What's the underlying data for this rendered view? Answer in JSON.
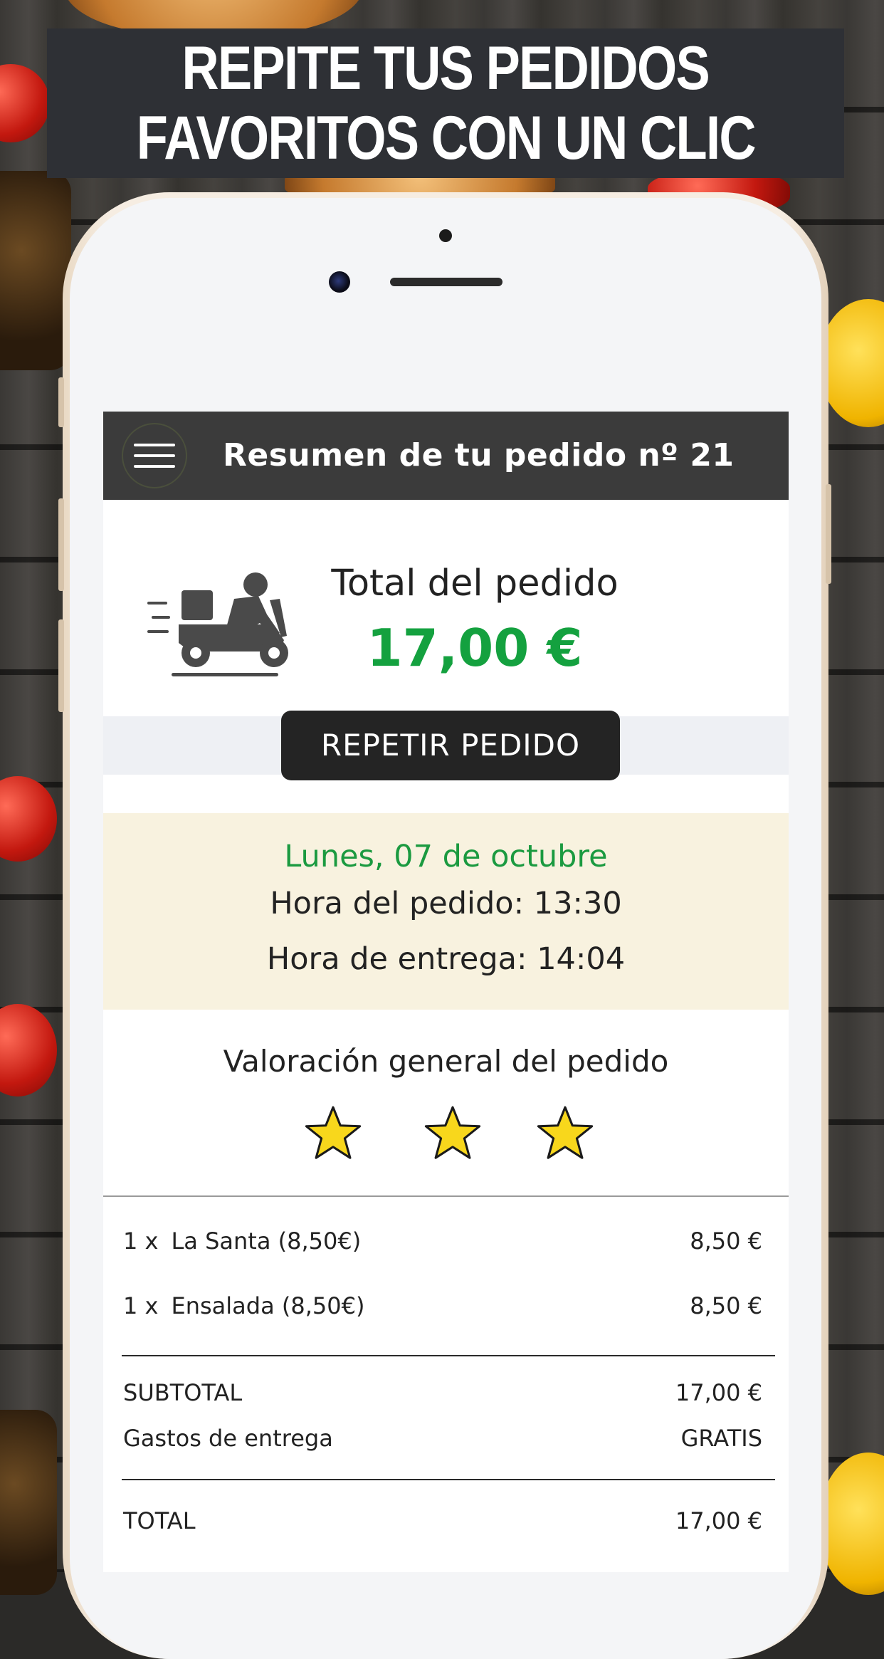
{
  "banner": {
    "line1": "REPITE TUS PEDIDOS",
    "line2": "FAVORITOS CON UN CLIC"
  },
  "app": {
    "header_title": "Resumen de tu pedido nº 21",
    "menu_icon": "hamburger-menu-icon"
  },
  "summary": {
    "icon": "delivery-scooter-icon",
    "total_label": "Total del pedido",
    "total_value": "17,00 €",
    "repeat_button": "REPETIR PEDIDO"
  },
  "dates": {
    "date": "Lunes, 07 de octubre",
    "order_time": "Hora del pedido: 13:30",
    "delivery_time": "Hora de entrega: 14:04"
  },
  "rating": {
    "title": "Valoración general del pedido",
    "stars": 3,
    "star_color": "#f8d71c"
  },
  "items": [
    {
      "qty": "1 x",
      "name": "La Santa (8,50€)",
      "price": "8,50 €"
    },
    {
      "qty": "1 x",
      "name": "Ensalada (8,50€)",
      "price": "8,50 €"
    }
  ],
  "totals": {
    "subtotal_label": "SUBTOTAL",
    "subtotal_value": "17,00 €",
    "delivery_label": "Gastos de entrega",
    "delivery_value": "GRATIS",
    "total_label": "TOTAL",
    "total_value": "17,00 €"
  },
  "colors": {
    "accent_green": "#14a13f",
    "header_bg": "#3b3b3b",
    "date_bg": "#f8f2df"
  }
}
